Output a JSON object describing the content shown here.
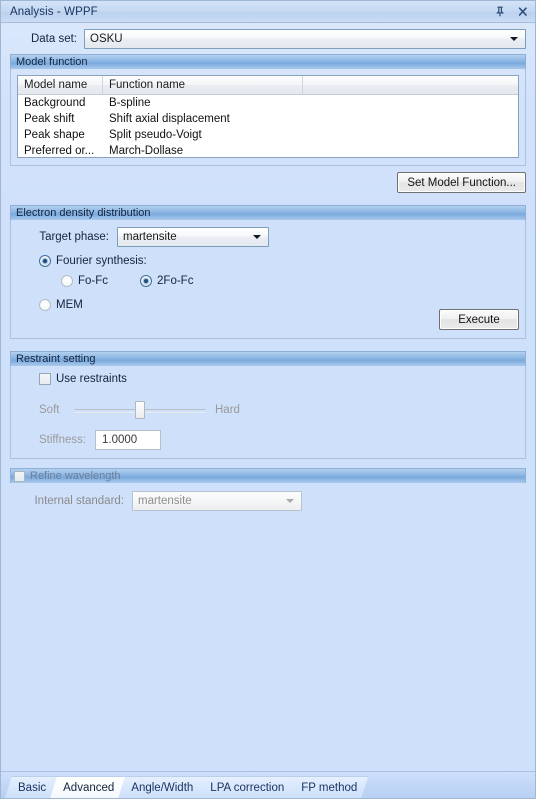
{
  "window": {
    "title": "Analysis - WPPF",
    "pin_icon": "pin-icon",
    "close_icon": "close-icon"
  },
  "dataset": {
    "label": "Data set:",
    "value": "OSKU",
    "arrow_icon": "chevron-down-icon"
  },
  "model_function": {
    "group_title": "Model function",
    "columns": [
      "Model name",
      "Function name",
      ""
    ],
    "rows": [
      [
        "Background",
        "B-spline",
        ""
      ],
      [
        "Peak shift",
        "Shift axial displacement",
        ""
      ],
      [
        "Peak shape",
        "Split pseudo-Voigt",
        ""
      ],
      [
        "Preferred or...",
        "March-Dollase",
        ""
      ]
    ],
    "set_button": "Set Model Function..."
  },
  "electron_density": {
    "group_title": "Electron density distribution",
    "target_phase_label": "Target phase:",
    "target_phase_value": "martensite",
    "fourier_label": "Fourier synthesis:",
    "fourier_selected": true,
    "fofc_label": "Fo-Fc",
    "fofc_selected": false,
    "twofofc_label": "2Fo-Fc",
    "twofofc_selected": true,
    "mem_label": "MEM",
    "mem_selected": false,
    "execute_button": "Execute"
  },
  "restraint": {
    "group_title": "Restraint setting",
    "use_restraints_label": "Use restraints",
    "use_restraints_checked": false,
    "slider_min_label": "Soft",
    "slider_max_label": "Hard",
    "slider_value": 50,
    "stiffness_label": "Stiffness:",
    "stiffness_value": "1.0000"
  },
  "refine_wavelength": {
    "group_title": "Refine wavelength",
    "checked": false,
    "internal_standard_label": "Internal standard:",
    "internal_standard_value": "martensite"
  },
  "tabs": [
    {
      "label": "Basic",
      "selected": false
    },
    {
      "label": "Advanced",
      "selected": true
    },
    {
      "label": "Angle/Width",
      "selected": false
    },
    {
      "label": "LPA correction",
      "selected": false
    },
    {
      "label": "FP method",
      "selected": false
    }
  ],
  "colors": {
    "background": "#cfe0fb",
    "group_header_blue": "#7aa9dd",
    "title_text": "#16335e",
    "radio_dot": "#1d4f80"
  }
}
